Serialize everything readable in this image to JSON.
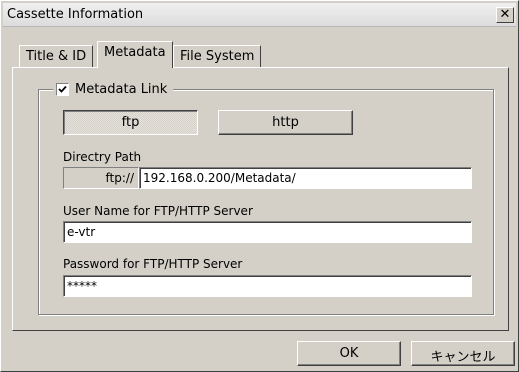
{
  "window": {
    "title": "Cassette Information",
    "close_glyph": "✕"
  },
  "tabs": [
    {
      "label": "Title & ID",
      "active": false
    },
    {
      "label": "Metadata",
      "active": true
    },
    {
      "label": "File System",
      "active": false
    }
  ],
  "metadata_group": {
    "checkbox_label": "Metadata Link",
    "checked": true,
    "protocol_buttons": [
      {
        "label": "ftp",
        "pressed": true
      },
      {
        "label": "http",
        "pressed": false
      }
    ],
    "directory_label": "Directry Path",
    "directory_prefix": "ftp://",
    "directory_value": "192.168.0.200/Metadata/",
    "username_label": "User Name for FTP/HTTP Server",
    "username_value": "e-vtr",
    "password_label": "Password for FTP/HTTP Server",
    "password_value": "*****"
  },
  "footer": {
    "ok_label": "OK",
    "cancel_label": "キャンセル"
  }
}
